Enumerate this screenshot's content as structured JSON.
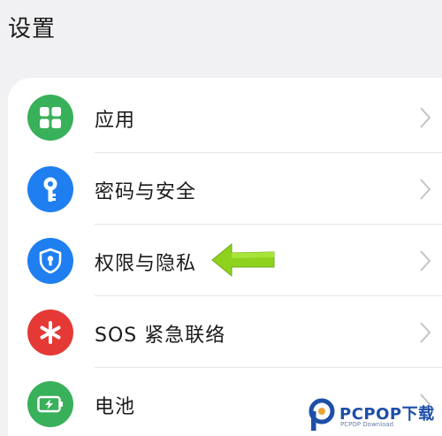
{
  "header": {
    "title": "设置"
  },
  "settings": {
    "items": [
      {
        "label": "应用",
        "icon": "apps-grid-icon",
        "color": "#39b05a"
      },
      {
        "label": "密码与安全",
        "icon": "key-icon",
        "color": "#1f7ff0"
      },
      {
        "label": "权限与隐私",
        "icon": "privacy-shield-icon",
        "color": "#1f7ff0"
      },
      {
        "label": "SOS 紧急联络",
        "icon": "sos-asterisk-icon",
        "color": "#e53935"
      },
      {
        "label": "电池",
        "icon": "battery-icon",
        "color": "#39b05a"
      }
    ]
  },
  "annotation": {
    "arrow_color": "#8ed21e"
  },
  "watermark": {
    "brand": "PCPOP下载",
    "sub": "PCPOP Download"
  }
}
